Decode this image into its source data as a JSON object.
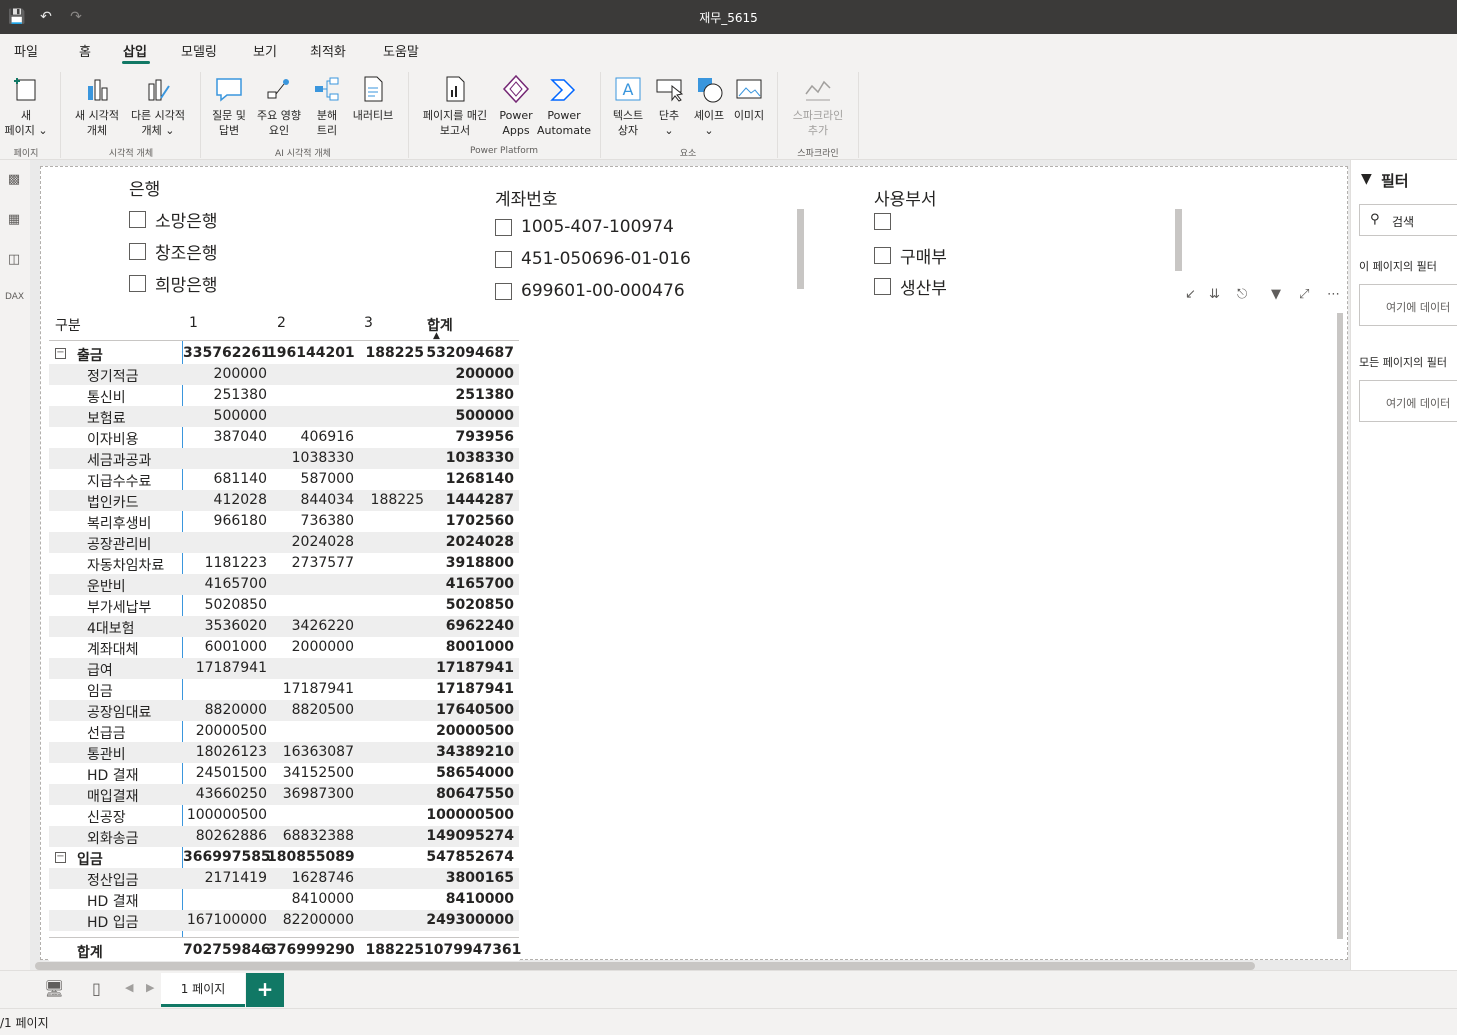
{
  "window": {
    "title": "재무_5615"
  },
  "menu": {
    "items": [
      "파일",
      "홈",
      "삽입",
      "모델링",
      "보기",
      "최적화",
      "도움말"
    ],
    "active": "삽입"
  },
  "ribbon": {
    "new_page": "새\n페이지",
    "new_visual": "새 시각적\n개체",
    "other_visual": "다른 시각적\n개체",
    "qa": "질문 및\n답변",
    "key_influencers": "주요 영향\n요인",
    "decomp_tree": "분해\n트리",
    "narrative": "내러티브",
    "paginated": "페이지를 매긴\n보고서",
    "power_apps": "Power\nApps",
    "power_automate": "Power\nAutomate",
    "textbox": "텍스트\n상자",
    "button": "단추",
    "shape": "셰이프",
    "image": "이미지",
    "sparkline": "스파크라인\n추가",
    "groups": {
      "page": "페이지",
      "visuals": "시각적 개체",
      "ai_visuals": "AI 시각적 개체",
      "power_platform": "Power Platform",
      "elements": "요소",
      "sparkline": "스파크라인"
    }
  },
  "slicers": {
    "bank": {
      "title": "은행",
      "items": [
        "소망은행",
        "창조은행",
        "희망은행"
      ]
    },
    "account": {
      "title": "계좌번호",
      "items": [
        "1005-407-100974",
        "451-050696-01-016",
        "699601-00-000476"
      ]
    },
    "dept": {
      "title": "사용부서",
      "items": [
        "",
        "구매부",
        "생산부"
      ]
    }
  },
  "matrix": {
    "headers": [
      "구분",
      "1",
      "2",
      "3",
      "합계"
    ],
    "groups": [
      {
        "label": "출금",
        "values": [
          "335762261",
          "196144201",
          "188225",
          "532094687"
        ],
        "rows": [
          [
            "정기적금",
            "200000",
            "",
            "",
            "200000"
          ],
          [
            "통신비",
            "251380",
            "",
            "",
            "251380"
          ],
          [
            "보험료",
            "500000",
            "",
            "",
            "500000"
          ],
          [
            "이자비용",
            "387040",
            "406916",
            "",
            "793956"
          ],
          [
            "세금과공과",
            "",
            "1038330",
            "",
            "1038330"
          ],
          [
            "지급수수료",
            "681140",
            "587000",
            "",
            "1268140"
          ],
          [
            "법인카드",
            "412028",
            "844034",
            "188225",
            "1444287"
          ],
          [
            "복리후생비",
            "966180",
            "736380",
            "",
            "1702560"
          ],
          [
            "공장관리비",
            "",
            "2024028",
            "",
            "2024028"
          ],
          [
            "자동차임차료",
            "1181223",
            "2737577",
            "",
            "3918800"
          ],
          [
            "운반비",
            "4165700",
            "",
            "",
            "4165700"
          ],
          [
            "부가세납부",
            "5020850",
            "",
            "",
            "5020850"
          ],
          [
            "4대보험",
            "3536020",
            "3426220",
            "",
            "6962240"
          ],
          [
            "계좌대체",
            "6001000",
            "2000000",
            "",
            "8001000"
          ],
          [
            "급여",
            "17187941",
            "",
            "",
            "17187941"
          ],
          [
            "임금",
            "",
            "17187941",
            "",
            "17187941"
          ],
          [
            "공장임대료",
            "8820000",
            "8820500",
            "",
            "17640500"
          ],
          [
            "선급금",
            "20000500",
            "",
            "",
            "20000500"
          ],
          [
            "통관비",
            "18026123",
            "16363087",
            "",
            "34389210"
          ],
          [
            "HD 결재",
            "24501500",
            "34152500",
            "",
            "58654000"
          ],
          [
            "매입결재",
            "43660250",
            "36987300",
            "",
            "80647550"
          ],
          [
            "신공장",
            "100000500",
            "",
            "",
            "100000500"
          ],
          [
            "외화송금",
            "80262886",
            "68832388",
            "",
            "149095274"
          ]
        ]
      },
      {
        "label": "입금",
        "values": [
          "366997585",
          "180855089",
          "",
          "547852674"
        ],
        "rows": [
          [
            "정산입금",
            "2171419",
            "1628746",
            "",
            "3800165"
          ],
          [
            "HD 결재",
            "",
            "8410000",
            "",
            "8410000"
          ],
          [
            "HD 입금",
            "167100000",
            "82200000",
            "",
            "249300000"
          ]
        ]
      }
    ],
    "total": {
      "label": "합계",
      "values": [
        "702759846",
        "376999290",
        "188225",
        "1079947361"
      ]
    }
  },
  "filters": {
    "title": "필터",
    "search_placeholder": "검색",
    "this_page": "이 페이지의 필터",
    "all_pages": "모든 페이지의 필터",
    "drop_here": "여기에 데이터"
  },
  "pages": {
    "tab": "1 페이지",
    "status": "/1 페이지"
  },
  "colors": {
    "accent": "#117865",
    "selection": "#3a96dd",
    "titlebar": "#3b3a39"
  }
}
